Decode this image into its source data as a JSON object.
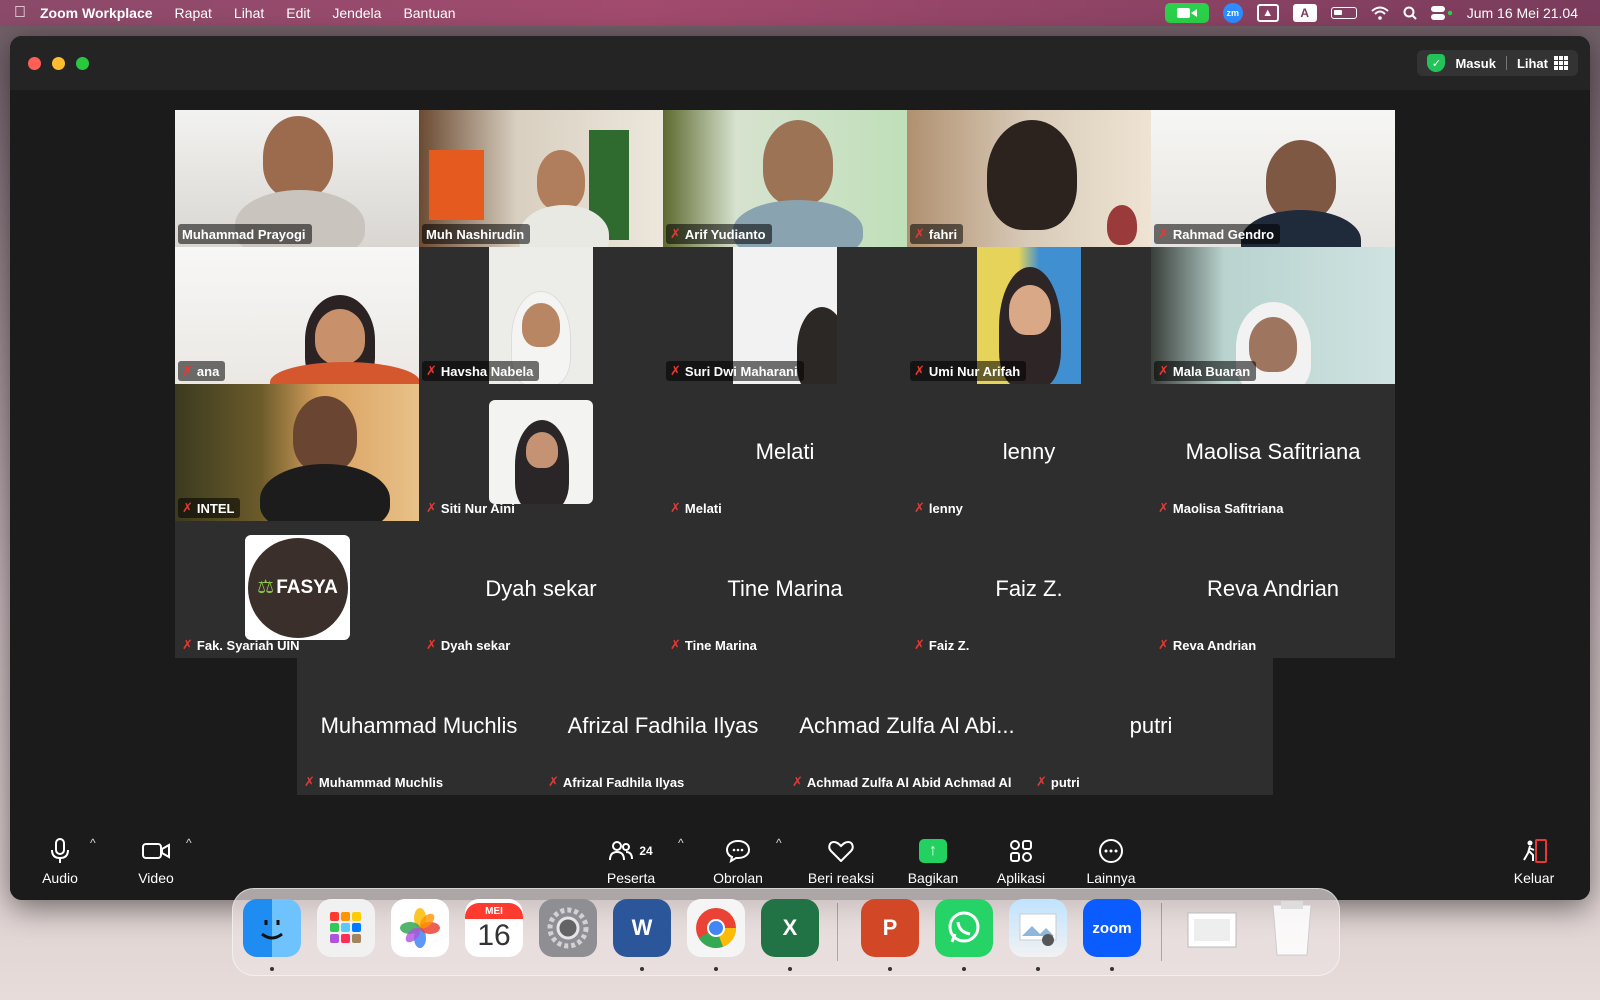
{
  "menubar": {
    "app_name": "Zoom Workplace",
    "menus": [
      "Rapat",
      "Lihat",
      "Edit",
      "Jendela",
      "Bantuan"
    ],
    "zm_badge": "zm",
    "input_source": "A",
    "datetime": "Jum 16 Mei  21.04"
  },
  "titlebar": {
    "signin_label": "Masuk",
    "view_label": "Lihat"
  },
  "colors": {
    "active_speaker": "#23d160",
    "muted_icon": "#e53935",
    "share_button": "#23d160"
  },
  "participants": [
    {
      "name": "Muhammad Prayogi",
      "video": true,
      "muted": false,
      "active": true
    },
    {
      "name": "Muh Nashirudin",
      "video": true,
      "muted": false
    },
    {
      "name": "Arif Yudianto",
      "video": true,
      "muted": true
    },
    {
      "name": "fahri",
      "video": true,
      "muted": true
    },
    {
      "name": "Rahmad Gendro",
      "video": true,
      "muted": true
    },
    {
      "name": "ana",
      "video": true,
      "muted": true
    },
    {
      "name": "Havsha Nabela",
      "video": true,
      "muted": true
    },
    {
      "name": "Suri Dwi Maharani",
      "video": true,
      "muted": true
    },
    {
      "name": "Umi Nur Arifah",
      "video": true,
      "muted": true
    },
    {
      "name": "Mala Buaran",
      "video": true,
      "muted": true
    },
    {
      "name": "INTEL",
      "video": true,
      "muted": true
    },
    {
      "name": "Siti Nur Aini",
      "video": true,
      "muted": true
    },
    {
      "name": "Melati",
      "display": "Melati",
      "video": false,
      "muted": true
    },
    {
      "name": "lenny",
      "display": "lenny",
      "video": false,
      "muted": true
    },
    {
      "name": "Maolisa Safitriana",
      "display": "Maolisa Safitriana",
      "video": false,
      "muted": true
    },
    {
      "name": "Fak. Syariah UIN",
      "logo_text": "FASYA",
      "video": false,
      "muted": true
    },
    {
      "name": "Dyah sekar",
      "display": "Dyah sekar",
      "video": false,
      "muted": true
    },
    {
      "name": "Tine Marina",
      "display": "Tine Marina",
      "video": false,
      "muted": true
    },
    {
      "name": "Faiz Z.",
      "display": "Faiz Z.",
      "video": false,
      "muted": true
    },
    {
      "name": "Reva Andrian",
      "display": "Reva Andrian",
      "video": false,
      "muted": true
    },
    {
      "name": "Muhammad Muchlis",
      "display": "Muhammad Muchlis",
      "video": false,
      "muted": true
    },
    {
      "name": "Afrizal Fadhila Ilyas",
      "display": "Afrizal Fadhila Ilyas",
      "video": false,
      "muted": true
    },
    {
      "name": "Achmad Zulfa Al Abid Achmad Al",
      "display": "Achmad Zulfa Al Abi...",
      "video": false,
      "muted": true
    },
    {
      "name": "putri",
      "display": "putri",
      "video": false,
      "muted": true
    }
  ],
  "toolbar": {
    "audio": "Audio",
    "video": "Video",
    "participants": "Peserta",
    "participants_count": "24",
    "chat": "Obrolan",
    "reactions": "Beri reaksi",
    "share": "Bagikan",
    "apps": "Aplikasi",
    "more": "Lainnya",
    "leave": "Keluar"
  },
  "dock": {
    "calendar_month": "MEI",
    "calendar_day": "16",
    "zoom_label": "zoom",
    "word_letter": "W",
    "excel_letter": "X",
    "ppt_letter": "P",
    "icons": [
      "finder-icon",
      "launchpad-icon",
      "photos-icon",
      "calendar-icon",
      "system-settings-icon",
      "word-icon",
      "chrome-icon",
      "excel-icon",
      "powerpoint-icon",
      "whatsapp-icon",
      "preview-icon",
      "zoom-icon",
      "downloads-icon",
      "trash-icon"
    ]
  }
}
